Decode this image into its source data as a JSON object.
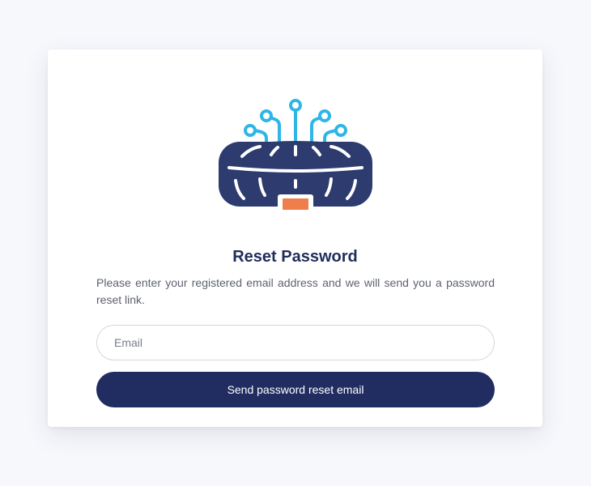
{
  "reset": {
    "title": "Reset Password",
    "description": "Please enter your registered email address and we will send you a password reset link.",
    "email_placeholder": "Email",
    "submit_label": "Send password reset email"
  },
  "colors": {
    "accent": "#212d61",
    "title": "#1f2d5c",
    "logo_body": "#2e3b6e",
    "logo_circuit": "#2fb6e6",
    "logo_light": "#ee7e4c"
  },
  "icons": {
    "logo": "router-circuit-logo-icon"
  }
}
